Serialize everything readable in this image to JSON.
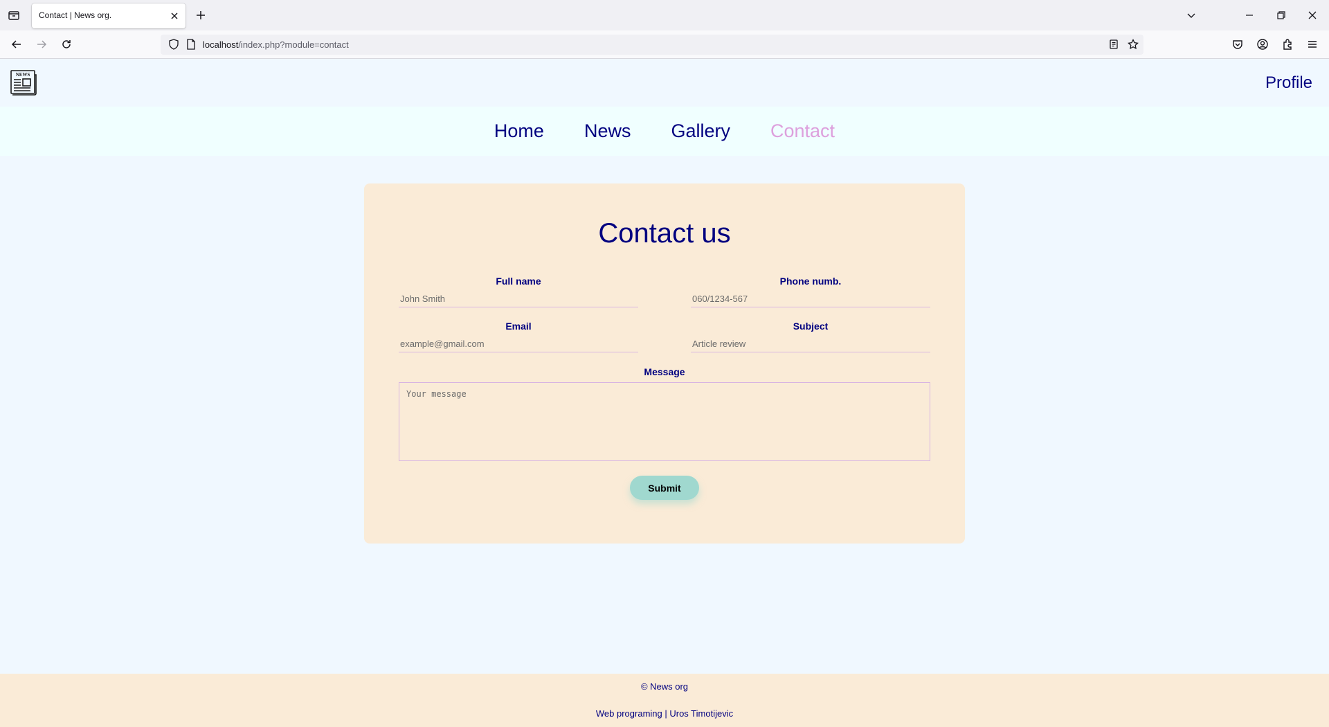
{
  "browser": {
    "tab_title": "Contact | News org.",
    "url_host": "localhost",
    "url_path": "/index.php?module=contact"
  },
  "site": {
    "logo_text": "NEWS",
    "profile_label": "Profile",
    "nav": [
      {
        "label": "Home"
      },
      {
        "label": "News"
      },
      {
        "label": "Gallery"
      },
      {
        "label": "Contact",
        "active": true
      }
    ]
  },
  "form": {
    "title": "Contact us",
    "full_name_label": "Full name",
    "full_name_placeholder": "John Smith",
    "phone_label": "Phone numb.",
    "phone_placeholder": "060/1234-567",
    "email_label": "Email",
    "email_placeholder": "example@gmail.com",
    "subject_label": "Subject",
    "subject_placeholder": "Article review",
    "message_label": "Message",
    "message_placeholder": "Your message",
    "submit_label": "Submit"
  },
  "footer": {
    "copyright": "© News org",
    "credits": "Web programing | Uros Timotijevic"
  },
  "colors": {
    "page_bg": "#f0f8ff",
    "nav_bg": "#f0ffff",
    "card_bg": "#faebd7",
    "link": "#000080",
    "active_link": "#dda0dd",
    "button": "#a0d8cf"
  }
}
